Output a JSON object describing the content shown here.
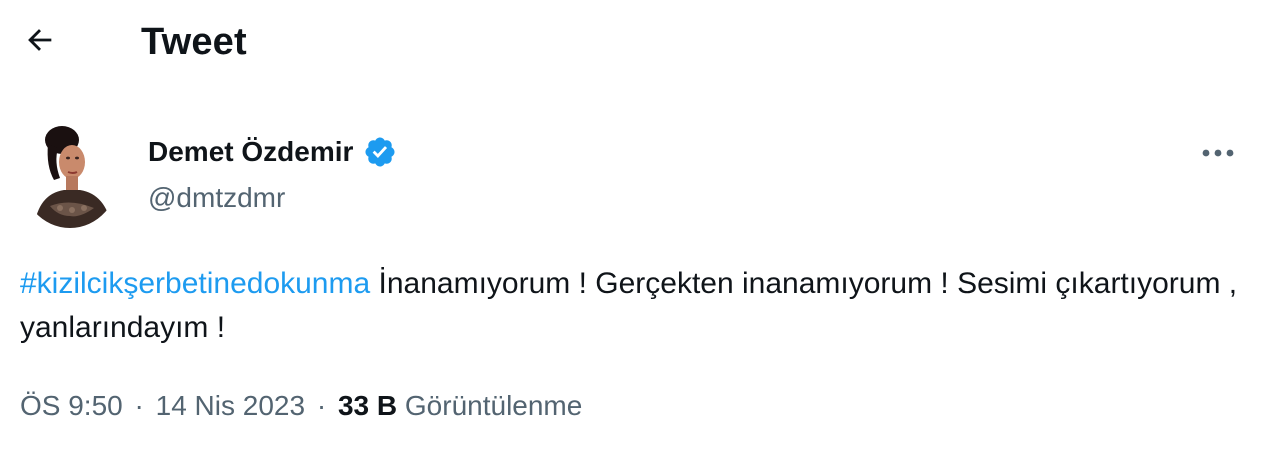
{
  "header": {
    "title": "Tweet",
    "back_icon": "arrow-left-icon"
  },
  "author": {
    "display_name": "Demet Özdemir",
    "handle": "@dmtzdmr",
    "verified_icon": "verified-badge-icon",
    "verified_color": "#1d9bf0"
  },
  "more_icon": "more-horizontal-icon",
  "tweet": {
    "hashtag": "#kizilcikşerbetinedokunma",
    "text": " İnanamıyorum ! Gerçekten inanamıyorum ! Sesimi çıkartıyorum , yanlarındayım !"
  },
  "meta": {
    "time": "ÖS 9:50",
    "separator": "·",
    "date": "14 Nis 2023",
    "views_count": "33 B",
    "views_label": "Görüntülenme"
  },
  "colors": {
    "link": "#1d9bf0",
    "secondary_text": "#536471",
    "primary_text": "#0f1419"
  }
}
